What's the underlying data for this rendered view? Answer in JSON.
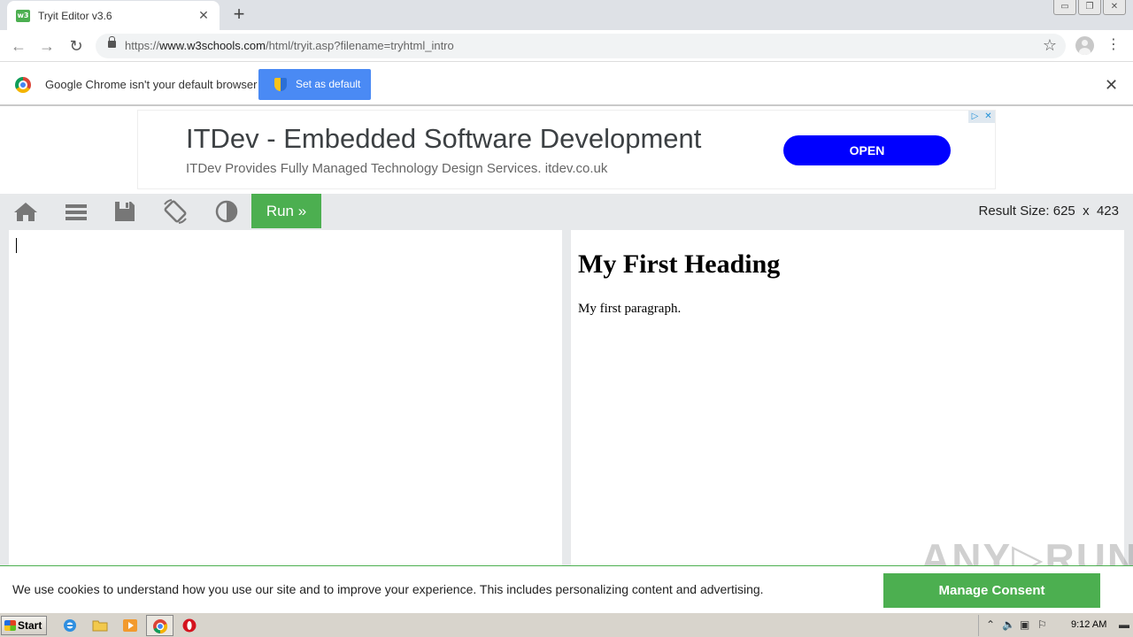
{
  "browser": {
    "tab_title": "Tryit Editor v3.6",
    "favicon_text": "w3",
    "url_scheme": "https://",
    "url_host": "www.w3schools.com",
    "url_path": "/html/tryit.asp?filename=tryhtml_intro"
  },
  "infobar": {
    "message": "Google Chrome isn't your default browser",
    "button_label": "Set as default"
  },
  "ad": {
    "title": "ITDev - Embedded Software Development",
    "subtitle": "ITDev Provides Fully Managed Technology Design Services. itdev.co.uk",
    "button_label": "OPEN"
  },
  "tryit": {
    "run_label": "Run »",
    "result_size_label": "Result Size:",
    "result_width": "625",
    "result_x": "x",
    "result_height": "423"
  },
  "result": {
    "heading": "My First Heading",
    "paragraph": "My first paragraph."
  },
  "cookie": {
    "message": "We use cookies to understand how you use our site and to improve your experience. This includes personalizing content and advertising.",
    "button_label": "Manage Consent"
  },
  "watermark": "ANY.RUN",
  "taskbar": {
    "start_label": "Start",
    "clock": "9:12 AM"
  },
  "colors": {
    "w3_green": "#4CAF50",
    "chrome_blue": "#4a8af4",
    "ad_button": "#0000ff"
  }
}
